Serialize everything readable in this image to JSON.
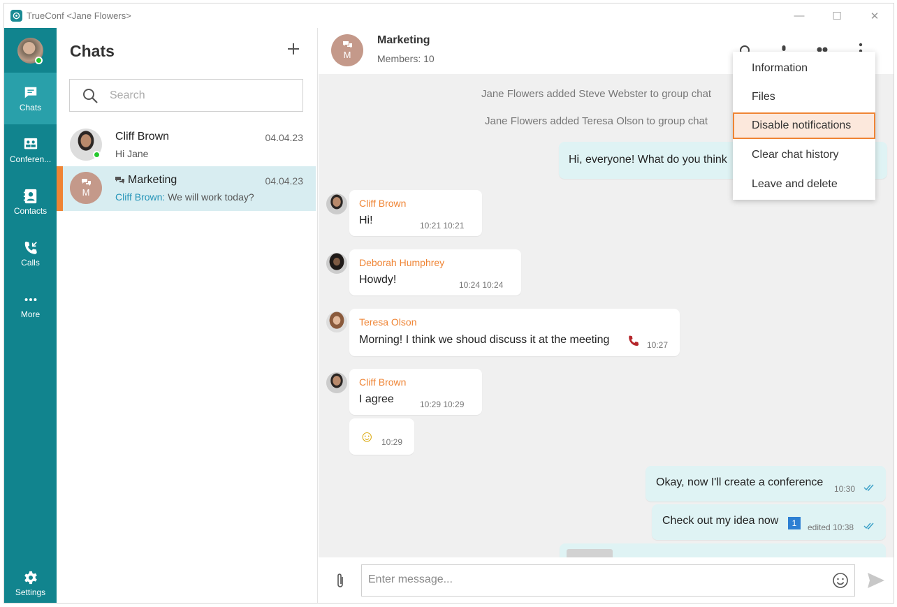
{
  "window": {
    "title": "TrueConf <Jane Flowers>"
  },
  "rail": {
    "items": [
      {
        "label": "Chats",
        "icon": "chat-icon"
      },
      {
        "label": "Conferen...",
        "icon": "conference-icon"
      },
      {
        "label": "Contacts",
        "icon": "contacts-icon"
      },
      {
        "label": "Calls",
        "icon": "calls-icon"
      },
      {
        "label": "More",
        "icon": "more-icon"
      }
    ],
    "settings_label": "Settings"
  },
  "chatlist": {
    "header": "Chats",
    "search_placeholder": "Search",
    "conversations": [
      {
        "name": "Cliff Brown",
        "date": "04.04.23",
        "preview": "Hi Jane"
      },
      {
        "name": "Marketing",
        "date": "04.04.23",
        "preview_sender": "Cliff Brown:",
        "preview": " We will work today?",
        "avatar_letter": "M"
      }
    ]
  },
  "chat": {
    "title": "Marketing",
    "members": "Members: 10",
    "avatar_letter": "M",
    "system_messages": [
      "Jane Flowers added Steve Webster to group chat",
      "Jane Flowers added Teresa Olson to group chat"
    ],
    "messages": [
      {
        "text": "Hi, everyone! What do you think"
      },
      {
        "sender": "Cliff Brown",
        "text": "Hi!",
        "time": "10:21 10:21"
      },
      {
        "sender": "Deborah Humphrey",
        "text": "Howdy!",
        "time": "10:24 10:24"
      },
      {
        "sender": "Teresa Olson",
        "text": "Morning! I think we shoud discuss it at the meeting",
        "time": "10:27"
      },
      {
        "sender": "Cliff Brown",
        "text": "I agree",
        "time": "10:29 10:29"
      },
      {
        "emoji": "☺",
        "time": "10:29"
      },
      {
        "text": "Okay, now I'll create a conference",
        "time": "10:30"
      },
      {
        "text": "Check out my idea now",
        "badge": "1",
        "time": "edited 10:38"
      }
    ],
    "compose_placeholder": "Enter message..."
  },
  "menu": {
    "items": [
      "Information",
      "Files",
      "Disable notifications",
      "Clear chat history",
      "Leave and delete"
    ]
  },
  "colors": {
    "rail": "#11848e",
    "rail_active": "#29a0aa",
    "accent": "#ef8434",
    "outgoing": "#dff3f4"
  }
}
